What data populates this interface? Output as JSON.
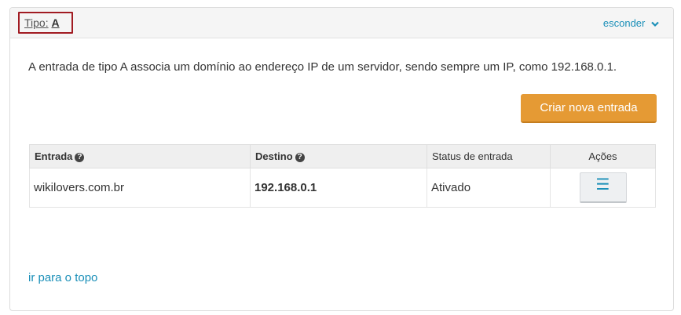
{
  "header": {
    "tipo_label": "Tipo:",
    "tipo_value": "A",
    "toggle_label": "esconder"
  },
  "description": "A entrada de tipo A associa um domínio ao endereço IP de um servidor, sendo sempre um IP, como 192.168.0.1.",
  "create_button": "Criar nova entrada",
  "table": {
    "columns": [
      "Entrada",
      "Destino",
      "Status de entrada",
      "Ações"
    ],
    "rows": [
      {
        "entrada": "wikilovers.com.br",
        "destino": "192.168.0.1",
        "status": "Ativado"
      }
    ]
  },
  "footer_link": "ir para o topo",
  "colors": {
    "accent": "#1a8fb8",
    "button": "#e59a34",
    "highlight": "#a11b22"
  }
}
